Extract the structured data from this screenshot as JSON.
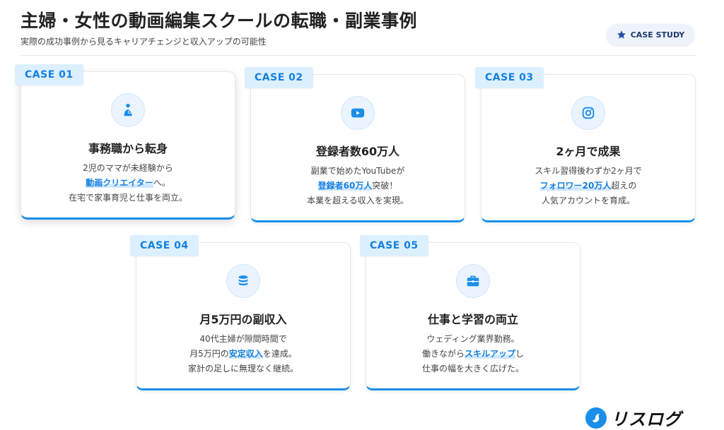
{
  "header": {
    "title": "主婦・女性の動画編集スクールの転職・副業事例",
    "subtitle": "実際の成功事例から見るキャリアチェンジと収入アップの可能性",
    "badge_label": "CASE STUDY"
  },
  "cases": [
    {
      "tag": "CASE 01",
      "icon": "mother-child-icon",
      "title": "事務職から転身",
      "line1": "2児のママが未経験から",
      "line2_highlight": "動画クリエイター",
      "line2_rest": "へ。",
      "line3": "在宅で家事育児と仕事を両立。"
    },
    {
      "tag": "CASE 02",
      "icon": "youtube-icon",
      "title": "登録者数60万人",
      "line1": "副業で始めたYouTubeが",
      "line2_highlight": "登録者60万人",
      "line2_rest": "突破！",
      "line3": "本業を超える収入を実現。"
    },
    {
      "tag": "CASE 03",
      "icon": "instagram-icon",
      "title": "2ヶ月で成果",
      "line1": "スキル習得後わずか2ヶ月で",
      "line2_highlight": "フォロワー20万人",
      "line2_rest": "超えの",
      "line3": "人気アカウントを育成。"
    },
    {
      "tag": "CASE 04",
      "icon": "coins-icon",
      "title": "月5万円の副収入",
      "line1": "40代主婦が隙間時間で",
      "line2_pre": "月5万円の",
      "line2_highlight": "安定収入",
      "line2_rest": "を達成。",
      "line3": "家計の足しに無理なく継続。"
    },
    {
      "tag": "CASE 05",
      "icon": "briefcase-icon",
      "title": "仕事と学習の両立",
      "line1": "ウェディング業界勤務。",
      "line2_pre": "働きながら",
      "line2_highlight": "スキルアップ",
      "line2_rest": "し",
      "line3": "仕事の幅を大きく広げた。"
    }
  ],
  "logo": {
    "text": "リスログ"
  },
  "colors": {
    "accent": "#1a8ee8",
    "tag_bg": "#dcefff",
    "highlight": "#1580e0"
  }
}
